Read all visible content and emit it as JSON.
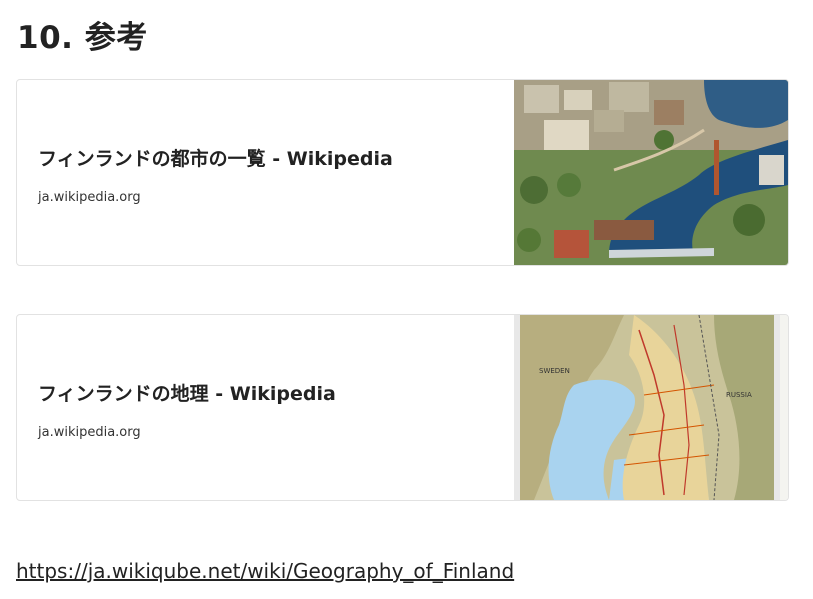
{
  "section": {
    "title": "10. 参考"
  },
  "cards": [
    {
      "title": "フィンランドの都市の一覧 - Wikipedia",
      "domain": "ja.wikipedia.org",
      "image": "aerial-city-photo"
    },
    {
      "title": "フィンランドの地理 - Wikipedia",
      "domain": "ja.wikipedia.org",
      "image": "finland-map",
      "map_labels": [
        "SWEDEN",
        "RUSSIA"
      ]
    }
  ],
  "link": {
    "text": "https://ja.wikiqube.net/wiki/Geography_of_Finland"
  }
}
